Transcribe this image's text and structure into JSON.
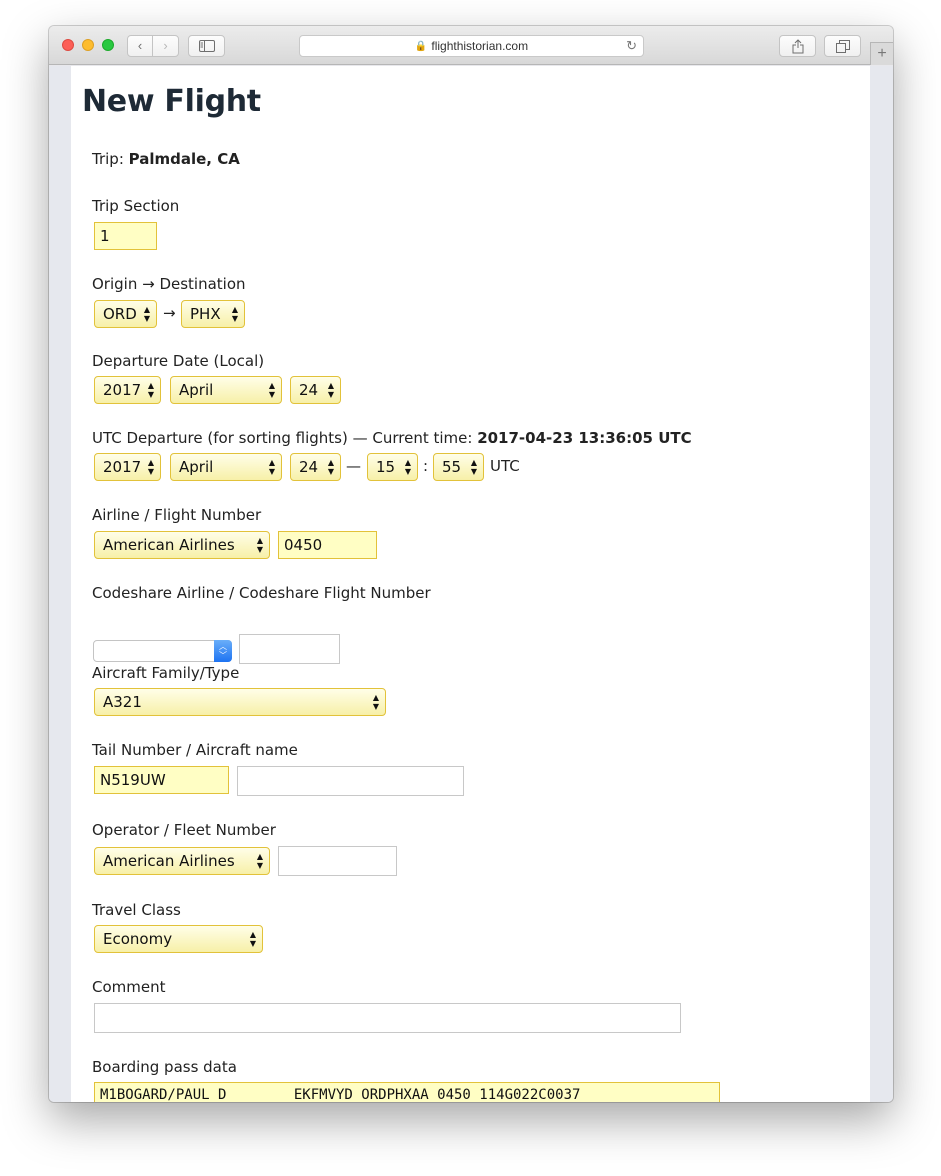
{
  "browser": {
    "url": "flighthistorian.com",
    "nav_back": "‹",
    "nav_forward": "›",
    "sidebar_icon": "sidebar-icon",
    "share_icon": "share-icon",
    "tabs_icon": "tabs-icon",
    "reload_icon": "↻",
    "new_tab": "+"
  },
  "page": {
    "title": "New Flight",
    "trip_label": "Trip: ",
    "trip_value": "Palmdale, CA",
    "trip_section": {
      "label": "Trip Section",
      "value": "1"
    },
    "route": {
      "label": "Origin → Destination",
      "origin": "ORD",
      "arrow": "→",
      "destination": "PHX"
    },
    "departure_date": {
      "label": "Departure Date (Local)",
      "year": "2017",
      "month": "April",
      "day": "24"
    },
    "utc_departure": {
      "label": "UTC Departure (for sorting flights) — Current time: ",
      "current_time": "2017-04-23 13:36:05 UTC",
      "year": "2017",
      "month": "April",
      "day": "24",
      "dash": "—",
      "hour": "15",
      "colon": ":",
      "minute": "55",
      "suffix": "UTC"
    },
    "airline": {
      "label": "Airline / Flight Number",
      "airline": "American Airlines",
      "flight_number": "0450"
    },
    "codeshare": {
      "label": "Codeshare Airline / Codeshare Flight Number",
      "airline": "",
      "flight_number": ""
    },
    "aircraft": {
      "label": "Aircraft Family/Type",
      "value": "A321"
    },
    "tail": {
      "label": "Tail Number / Aircraft name",
      "tail_number": "N519UW",
      "aircraft_name": ""
    },
    "operator": {
      "label": "Operator / Fleet Number",
      "operator": "American Airlines",
      "fleet_number": ""
    },
    "travel_class": {
      "label": "Travel Class",
      "value": "Economy"
    },
    "comment": {
      "label": "Comment",
      "value": ""
    },
    "boarding_pass": {
      "label": "Boarding pass data",
      "value": "M1BOGARD/PAUL D        EKFMVYD ORDPHXAA 0450 114G022C0037"
    }
  }
}
